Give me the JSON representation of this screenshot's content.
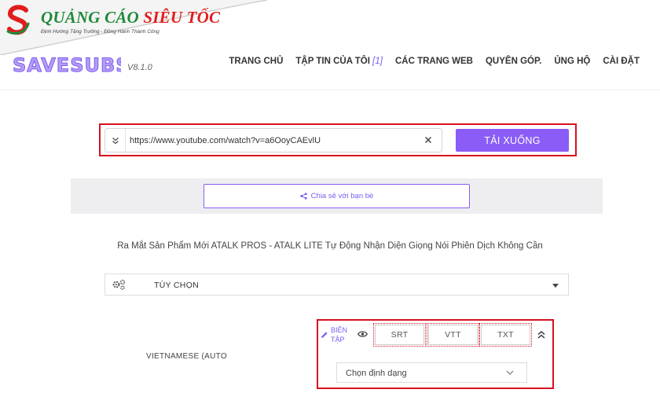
{
  "watermark": {
    "brand_part1": "QUẢNG CÁO",
    "brand_part2": "SIÊU TỐC",
    "tagline": "Định Hướng Tăng Trưởng - Đồng Hành Thành Công",
    "colors": {
      "green": "#1f8a3a",
      "red": "#e11d1d"
    }
  },
  "header": {
    "logo_text": "SAVESUBS",
    "version": "V8.1.0",
    "nav": [
      {
        "label": "TRANG CHỦ"
      },
      {
        "label": "TẬP TIN CỦA TÔI",
        "count": "[1]"
      },
      {
        "label": "CÁC TRANG WEB"
      },
      {
        "label": "QUYÊN GÓP."
      },
      {
        "label": "ỦNG HỘ"
      },
      {
        "label": "CÀI ĐẶT"
      }
    ]
  },
  "search": {
    "url_value": "https://www.youtube.com/watch?v=a6OoyCAEvlU",
    "download_label": "TẢI XUỐNG",
    "expand_icon": "double-chevron-down-icon",
    "clear_icon": "close-icon"
  },
  "share": {
    "label": "Chia sẻ với bạn bè",
    "icon": "share-icon"
  },
  "video": {
    "title": "Ra Mắt Sản Phẩm Mới ATALK PROS - ATALK LITE Tự Động Nhận Diện Giọng Nói Phiên Dịch Không Cần"
  },
  "options": {
    "label": "TÙY CHỌN",
    "icon": "gears-icon"
  },
  "subtitle": {
    "language": "VIETNAMESE (AUTO",
    "edit_label": "BIÊN TẬP",
    "formats": [
      "SRT",
      "VTT",
      "TXT"
    ],
    "format_select_placeholder": "Chọn định dạng"
  },
  "colors": {
    "accent": "#8b5cf6",
    "highlight": "#d8111f",
    "share_band": "#eeeef0"
  }
}
